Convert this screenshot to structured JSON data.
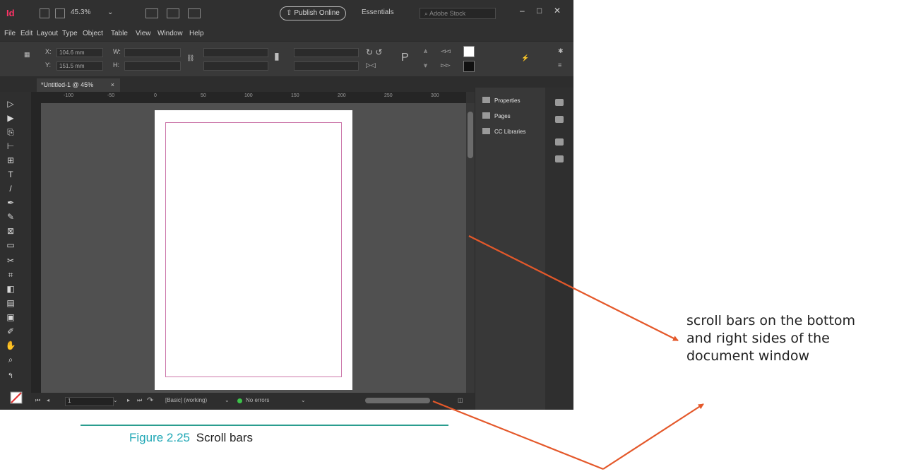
{
  "app": {
    "logo": "Id",
    "zoom": "45.3%",
    "publish_label": "Publish Online",
    "workspace": "Essentials",
    "search_placeholder": "Adobe Stock",
    "menu": [
      "File",
      "Edit",
      "Layout",
      "Type",
      "Object",
      "Table",
      "View",
      "Window",
      "Help"
    ],
    "control_panel": {
      "x_value": "104.6 mm",
      "y_value": "151.5 mm",
      "w_label": "W:",
      "h_label": "H:"
    },
    "doc_tab": "*Untitled-1 @ 45%",
    "ruler_ticks": [
      "-100",
      "-50",
      "0",
      "50",
      "100",
      "150",
      "200",
      "250",
      "300"
    ],
    "panels": [
      "Properties",
      "Pages",
      "CC Libraries"
    ],
    "status": {
      "page": "1",
      "style": "[Basic] (working)",
      "errors": "No errors"
    }
  },
  "annotation": {
    "lines": [
      "scroll bars on the bottom",
      "and right sides of the",
      "document window"
    ]
  },
  "figure": {
    "number": "Figure 2.25",
    "title": "Scroll bars"
  },
  "colors": {
    "arrow": "#e4582a",
    "caption_number": "#1ea7b5",
    "caption_rule": "#2a9d8f",
    "indesign_brand": "#ff3366"
  }
}
